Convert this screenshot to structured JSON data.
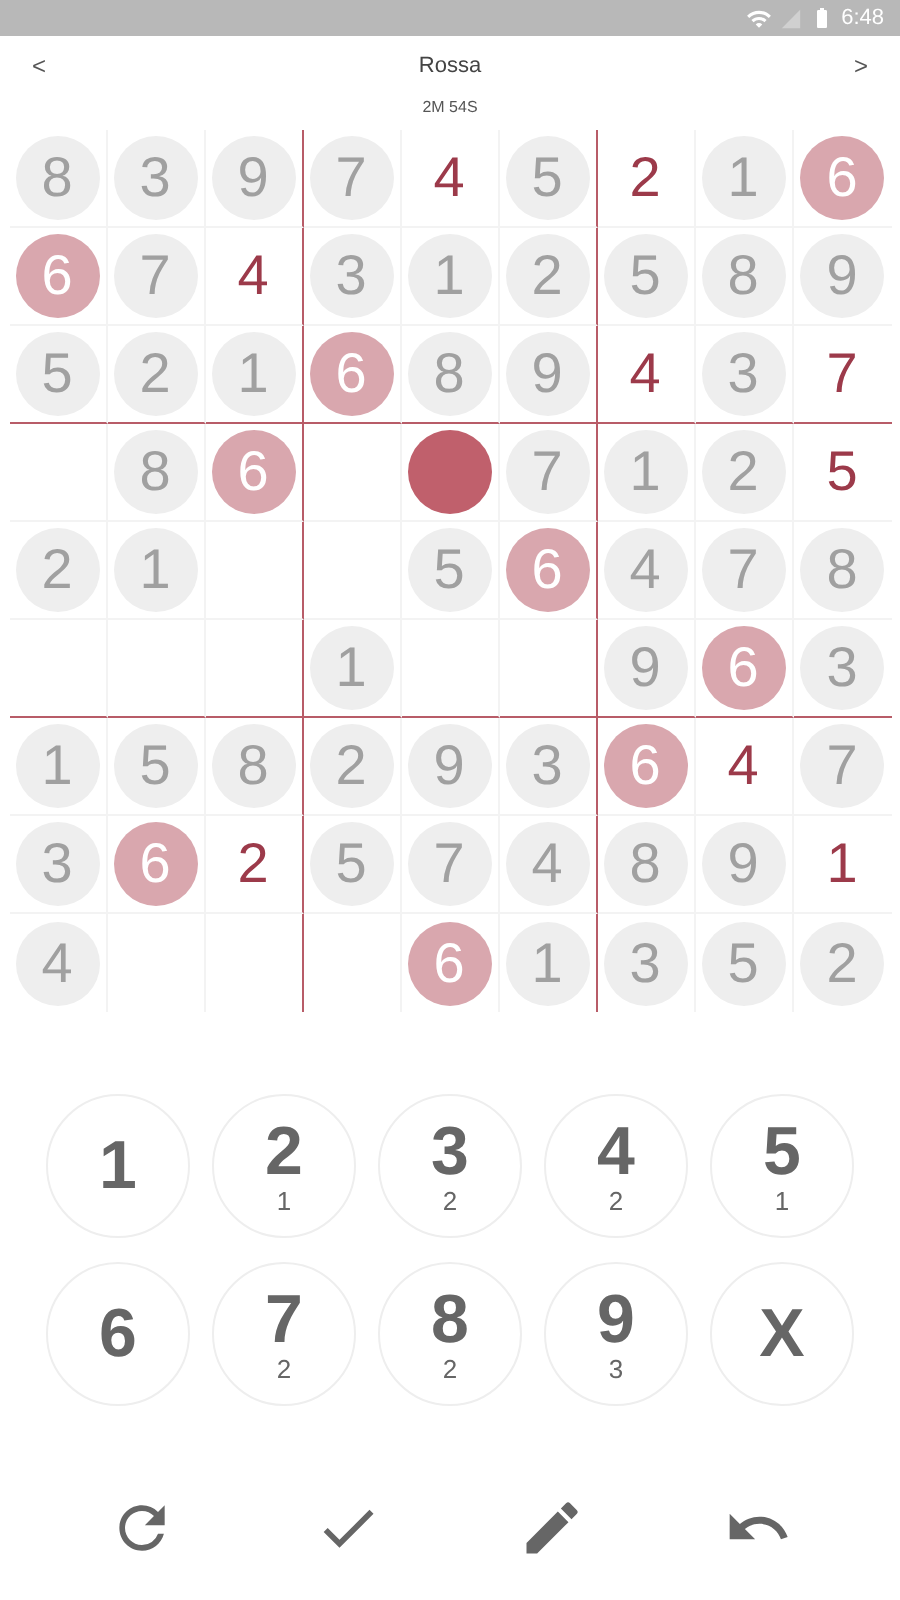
{
  "status_bar": {
    "time": "6:48"
  },
  "header": {
    "back": "<",
    "title": "Rossa",
    "forward": ">",
    "timer": "2M 54S"
  },
  "grid": [
    [
      {
        "kind": "given",
        "value": "8"
      },
      {
        "kind": "given",
        "value": "3"
      },
      {
        "kind": "given",
        "value": "9"
      },
      {
        "kind": "given",
        "value": "7"
      },
      {
        "kind": "entered",
        "value": "4"
      },
      {
        "kind": "given",
        "value": "5"
      },
      {
        "kind": "entered",
        "value": "2"
      },
      {
        "kind": "given",
        "value": "1"
      },
      {
        "kind": "highlight",
        "value": "6"
      }
    ],
    [
      {
        "kind": "highlight",
        "value": "6"
      },
      {
        "kind": "given",
        "value": "7"
      },
      {
        "kind": "entered",
        "value": "4"
      },
      {
        "kind": "given",
        "value": "3"
      },
      {
        "kind": "given",
        "value": "1"
      },
      {
        "kind": "given",
        "value": "2"
      },
      {
        "kind": "given",
        "value": "5"
      },
      {
        "kind": "given",
        "value": "8"
      },
      {
        "kind": "given",
        "value": "9"
      }
    ],
    [
      {
        "kind": "given",
        "value": "5"
      },
      {
        "kind": "given",
        "value": "2"
      },
      {
        "kind": "given",
        "value": "1"
      },
      {
        "kind": "highlight",
        "value": "6"
      },
      {
        "kind": "given",
        "value": "8"
      },
      {
        "kind": "given",
        "value": "9"
      },
      {
        "kind": "entered",
        "value": "4"
      },
      {
        "kind": "given",
        "value": "3"
      },
      {
        "kind": "entered",
        "value": "7"
      }
    ],
    [
      {
        "kind": "empty"
      },
      {
        "kind": "given",
        "value": "8"
      },
      {
        "kind": "highlight",
        "value": "6"
      },
      {
        "kind": "empty"
      },
      {
        "kind": "selected"
      },
      {
        "kind": "given",
        "value": "7"
      },
      {
        "kind": "given",
        "value": "1"
      },
      {
        "kind": "given",
        "value": "2"
      },
      {
        "kind": "entered",
        "value": "5"
      }
    ],
    [
      {
        "kind": "given",
        "value": "2"
      },
      {
        "kind": "given",
        "value": "1"
      },
      {
        "kind": "empty"
      },
      {
        "kind": "empty"
      },
      {
        "kind": "given",
        "value": "5"
      },
      {
        "kind": "highlight",
        "value": "6"
      },
      {
        "kind": "given",
        "value": "4"
      },
      {
        "kind": "given",
        "value": "7"
      },
      {
        "kind": "given",
        "value": "8"
      }
    ],
    [
      {
        "kind": "empty"
      },
      {
        "kind": "empty"
      },
      {
        "kind": "empty"
      },
      {
        "kind": "given",
        "value": "1"
      },
      {
        "kind": "empty"
      },
      {
        "kind": "empty"
      },
      {
        "kind": "given",
        "value": "9"
      },
      {
        "kind": "highlight",
        "value": "6"
      },
      {
        "kind": "given",
        "value": "3"
      }
    ],
    [
      {
        "kind": "given",
        "value": "1"
      },
      {
        "kind": "given",
        "value": "5"
      },
      {
        "kind": "given",
        "value": "8"
      },
      {
        "kind": "given",
        "value": "2"
      },
      {
        "kind": "given",
        "value": "9"
      },
      {
        "kind": "given",
        "value": "3"
      },
      {
        "kind": "highlight",
        "value": "6"
      },
      {
        "kind": "entered",
        "value": "4"
      },
      {
        "kind": "given",
        "value": "7"
      }
    ],
    [
      {
        "kind": "given",
        "value": "3"
      },
      {
        "kind": "highlight",
        "value": "6"
      },
      {
        "kind": "entered",
        "value": "2"
      },
      {
        "kind": "given",
        "value": "5"
      },
      {
        "kind": "given",
        "value": "7"
      },
      {
        "kind": "given",
        "value": "4"
      },
      {
        "kind": "given",
        "value": "8"
      },
      {
        "kind": "given",
        "value": "9"
      },
      {
        "kind": "entered",
        "value": "1"
      }
    ],
    [
      {
        "kind": "given",
        "value": "4"
      },
      {
        "kind": "empty"
      },
      {
        "kind": "empty"
      },
      {
        "kind": "empty"
      },
      {
        "kind": "highlight",
        "value": "6"
      },
      {
        "kind": "given",
        "value": "1"
      },
      {
        "kind": "given",
        "value": "3"
      },
      {
        "kind": "given",
        "value": "5"
      },
      {
        "kind": "given",
        "value": "2"
      }
    ]
  ],
  "keypad": [
    {
      "label": "1"
    },
    {
      "label": "2",
      "count": "1"
    },
    {
      "label": "3",
      "count": "2"
    },
    {
      "label": "4",
      "count": "2"
    },
    {
      "label": "5",
      "count": "1"
    },
    {
      "label": "6"
    },
    {
      "label": "7",
      "count": "2"
    },
    {
      "label": "8",
      "count": "2"
    },
    {
      "label": "9",
      "count": "3"
    },
    {
      "label": "X"
    }
  ],
  "toolbar": [
    {
      "kind": "restart"
    },
    {
      "kind": "check"
    },
    {
      "kind": "pencil"
    },
    {
      "kind": "undo"
    }
  ]
}
